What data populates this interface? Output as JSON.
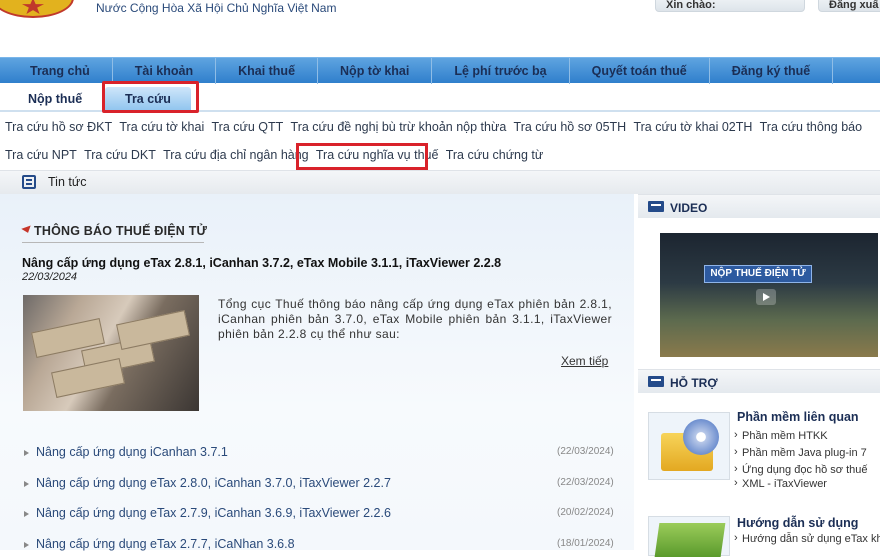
{
  "header": {
    "site_title": "Nước Cộng Hòa Xã Hội Chủ Nghĩa Việt Nam",
    "greeting": "Xin chào:",
    "logout": "Đăng xuấ"
  },
  "main_nav": [
    "Trang chủ",
    "Tài khoản",
    "Khai thuế",
    "Nộp tờ khai",
    "Lệ phí trước bạ",
    "Quyết toán thuế",
    "Đăng ký thuế"
  ],
  "sub_nav": {
    "tab1": "Nộp thuế",
    "tab2": "Tra cứu"
  },
  "links_row1": [
    "Tra cứu hồ sơ ĐKT",
    "Tra cứu tờ khai",
    "Tra cứu QTT",
    "Tra cứu đề nghị bù trừ khoản nộp thừa",
    "Tra cứu hồ sơ 05TH",
    "Tra cứu tờ khai 02TH",
    "Tra cứu thông báo"
  ],
  "links_row2": [
    "Tra cứu NPT",
    "Tra cứu DKT",
    "Tra cứu địa chỉ ngân hàng",
    "Tra cứu nghĩa vụ thuế",
    "Tra cứu chứng từ"
  ],
  "news_bar": {
    "label": "Tin tức"
  },
  "section": {
    "heading": "THÔNG BÁO THUẾ ĐIỆN TỬ"
  },
  "article": {
    "title": "Nâng cấp ứng dụng eTax 2.8.1, iCanhan 3.7.2, eTax Mobile 3.1.1, iTaxViewer 2.2.8",
    "date": "22/03/2024",
    "text": "Tổng cục Thuế thông báo nâng cấp ứng dụng eTax phiên bản 2.8.1, iCanhan phiên bản 3.7.0, eTax Mobile phiên bản 3.1.1, iTaxViewer phiên bản 2.2.8 cụ thể như sau:",
    "read_more": "Xem tiếp"
  },
  "news_list": [
    {
      "title": "Nâng cấp ứng dụng iCanhan 3.7.1",
      "date": "(22/03/2024)"
    },
    {
      "title": "Nâng cấp ứng dụng eTax 2.8.0, iCanhan 3.7.0, iTaxViewer 2.2.7",
      "date": "(22/03/2024)"
    },
    {
      "title": "Nâng cấp ứng dụng eTax 2.7.9, iCanhan 3.6.9, iTaxViewer 2.2.6",
      "date": "(20/02/2024)"
    },
    {
      "title": "Nâng cấp ứng dụng eTax 2.7.7, iCaNhan 3.6.8",
      "date": "(18/01/2024)"
    }
  ],
  "right": {
    "video_label": "VIDEO",
    "video_caption": "NỘP THUẾ ĐIỆN TỬ",
    "support_label": "HỖ TRỢ",
    "support_heading": "Phần mềm liên quan",
    "support_items": [
      "Phần mềm HTKK",
      "Phần mềm Java plug-in 7",
      "Ứng dụng đọc hồ sơ thuế",
      "XML - iTaxViewer"
    ],
    "guide_heading": "Hướng dẫn sử dụng",
    "guide_item": "Hướng dẫn sử dụng eTax khai"
  }
}
